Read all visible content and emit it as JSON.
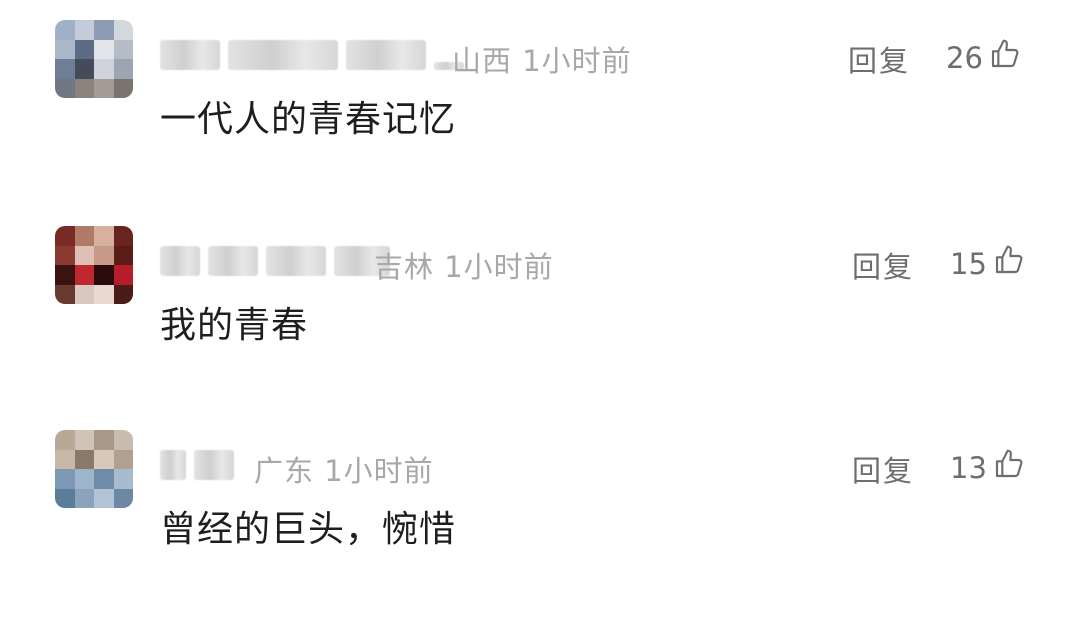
{
  "comments": [
    {
      "location": "山西",
      "time": "1小时前",
      "reply_label": "回复",
      "like_count": "26",
      "text": "一代人的青春记忆",
      "avatar_colors": [
        "#9fb0c8",
        "#c3ccd8",
        "#8b9cb4",
        "#d3d8de",
        "#aab8c8",
        "#5c6c84",
        "#e1e4e8",
        "#b4bcc8",
        "#6d7f96",
        "#444c5a",
        "#cfd4da",
        "#9aa6b4",
        "#707884",
        "#8c847c",
        "#a49c94",
        "#7a746e"
      ]
    },
    {
      "location": "吉林",
      "time": "1小时前",
      "reply_label": "回复",
      "like_count": "15",
      "text": "我的青春",
      "avatar_colors": [
        "#7a2a24",
        "#b07a66",
        "#d8b0a0",
        "#6a2420",
        "#8a3a30",
        "#e0c0b4",
        "#c89888",
        "#5a1c18",
        "#3a1210",
        "#c02830",
        "#2a0c0c",
        "#b81c28",
        "#6a3a30",
        "#d8c8c0",
        "#e8d8d0",
        "#4a1c18"
      ]
    },
    {
      "location": "广东",
      "time": "1小时前",
      "reply_label": "回复",
      "like_count": "13",
      "text": "曾经的巨头，惋惜",
      "avatar_colors": [
        "#b8a898",
        "#d0c4b8",
        "#a89888",
        "#c8bcb0",
        "#c8b8a8",
        "#8a7868",
        "#d8c8b8",
        "#b0a090",
        "#7c98b4",
        "#9cb4cc",
        "#6c8ca8",
        "#a8bcd0",
        "#5c7c9c",
        "#8aa4bc",
        "#b4c4d4",
        "#6c88a4"
      ]
    }
  ],
  "colors": {
    "meta": "#a8a8a8",
    "action": "#6e6e6e",
    "text": "#1e1e1e"
  },
  "icons": {
    "like": "thumbs-up-outline-icon"
  }
}
